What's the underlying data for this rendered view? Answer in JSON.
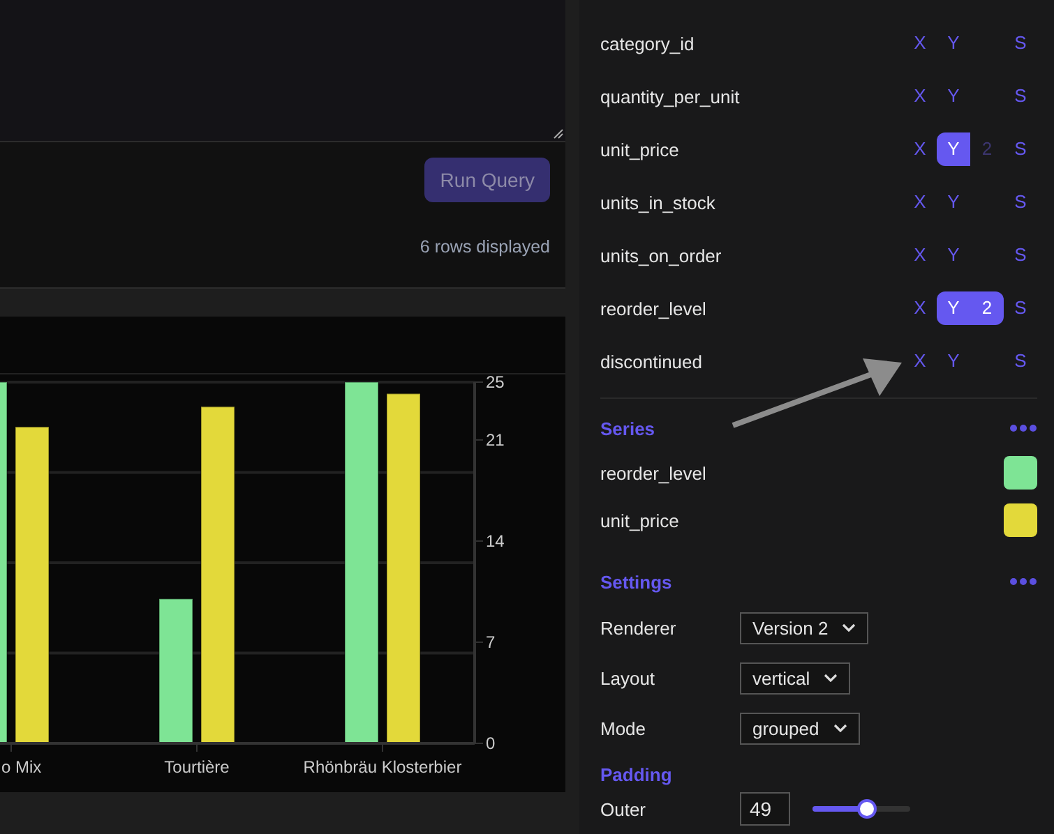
{
  "editor": {
    "resizable": true
  },
  "run_button": {
    "label": "Run Query",
    "disabled": true
  },
  "status": "6 rows displayed",
  "chart": {
    "chart_data": {
      "type": "bar",
      "categories": [
        "o Mix",
        "Tourtière",
        "Rhönbräu Klosterbier"
      ],
      "series": [
        {
          "color": "#7ee495",
          "values": [
            25,
            10,
            25
          ]
        },
        {
          "color": "#e3d93a",
          "values": [
            21.9,
            23.3,
            24.2
          ]
        }
      ],
      "ylim": [
        0,
        25
      ],
      "yticks": [
        0,
        7,
        14,
        21,
        25
      ]
    }
  },
  "fields": [
    {
      "name": "category_id",
      "axes": [
        {
          "kind": "x",
          "label": "X",
          "selected": false
        },
        {
          "kind": "y",
          "label": "Y",
          "selected": false
        },
        {
          "kind": "s",
          "label": "S",
          "selected": false
        }
      ]
    },
    {
      "name": "quantity_per_unit",
      "axes": [
        {
          "kind": "x",
          "label": "X",
          "selected": false
        },
        {
          "kind": "y",
          "label": "Y",
          "selected": false
        },
        {
          "kind": "s",
          "label": "S",
          "selected": false
        }
      ]
    },
    {
      "name": "unit_price",
      "axes": [
        {
          "kind": "x",
          "label": "X",
          "selected": false
        },
        {
          "kind": "y",
          "label": "Y",
          "selected": true
        },
        {
          "kind": "y2",
          "label": "2",
          "selected": false
        },
        {
          "kind": "s",
          "label": "S",
          "selected": false
        }
      ]
    },
    {
      "name": "units_in_stock",
      "axes": [
        {
          "kind": "x",
          "label": "X",
          "selected": false
        },
        {
          "kind": "y",
          "label": "Y",
          "selected": false
        },
        {
          "kind": "s",
          "label": "S",
          "selected": false
        }
      ]
    },
    {
      "name": "units_on_order",
      "axes": [
        {
          "kind": "x",
          "label": "X",
          "selected": false
        },
        {
          "kind": "y",
          "label": "Y",
          "selected": false
        },
        {
          "kind": "s",
          "label": "S",
          "selected": false
        }
      ]
    },
    {
      "name": "reorder_level",
      "axes": [
        {
          "kind": "x",
          "label": "X",
          "selected": false
        },
        {
          "kind": "y",
          "label": "Y",
          "selected": true
        },
        {
          "kind": "y2",
          "label": "2",
          "selected": true
        },
        {
          "kind": "s",
          "label": "S",
          "selected": false
        }
      ]
    },
    {
      "name": "discontinued",
      "axes": [
        {
          "kind": "x",
          "label": "X",
          "selected": false
        },
        {
          "kind": "y",
          "label": "Y",
          "selected": false
        },
        {
          "kind": "s",
          "label": "S",
          "selected": false
        }
      ]
    }
  ],
  "series_section": {
    "title": "Series",
    "items": [
      {
        "name": "reorder_level",
        "color": "#7ee495"
      },
      {
        "name": "unit_price",
        "color": "#e3d93a"
      }
    ]
  },
  "settings_section": {
    "title": "Settings",
    "items": [
      {
        "label": "Renderer",
        "value": "Version 2"
      },
      {
        "label": "Layout",
        "value": "vertical"
      },
      {
        "label": "Mode",
        "value": "grouped"
      }
    ]
  },
  "padding_section": {
    "title": "Padding",
    "items": [
      {
        "label": "Outer",
        "value": "49",
        "level": 0.55
      }
    ]
  }
}
